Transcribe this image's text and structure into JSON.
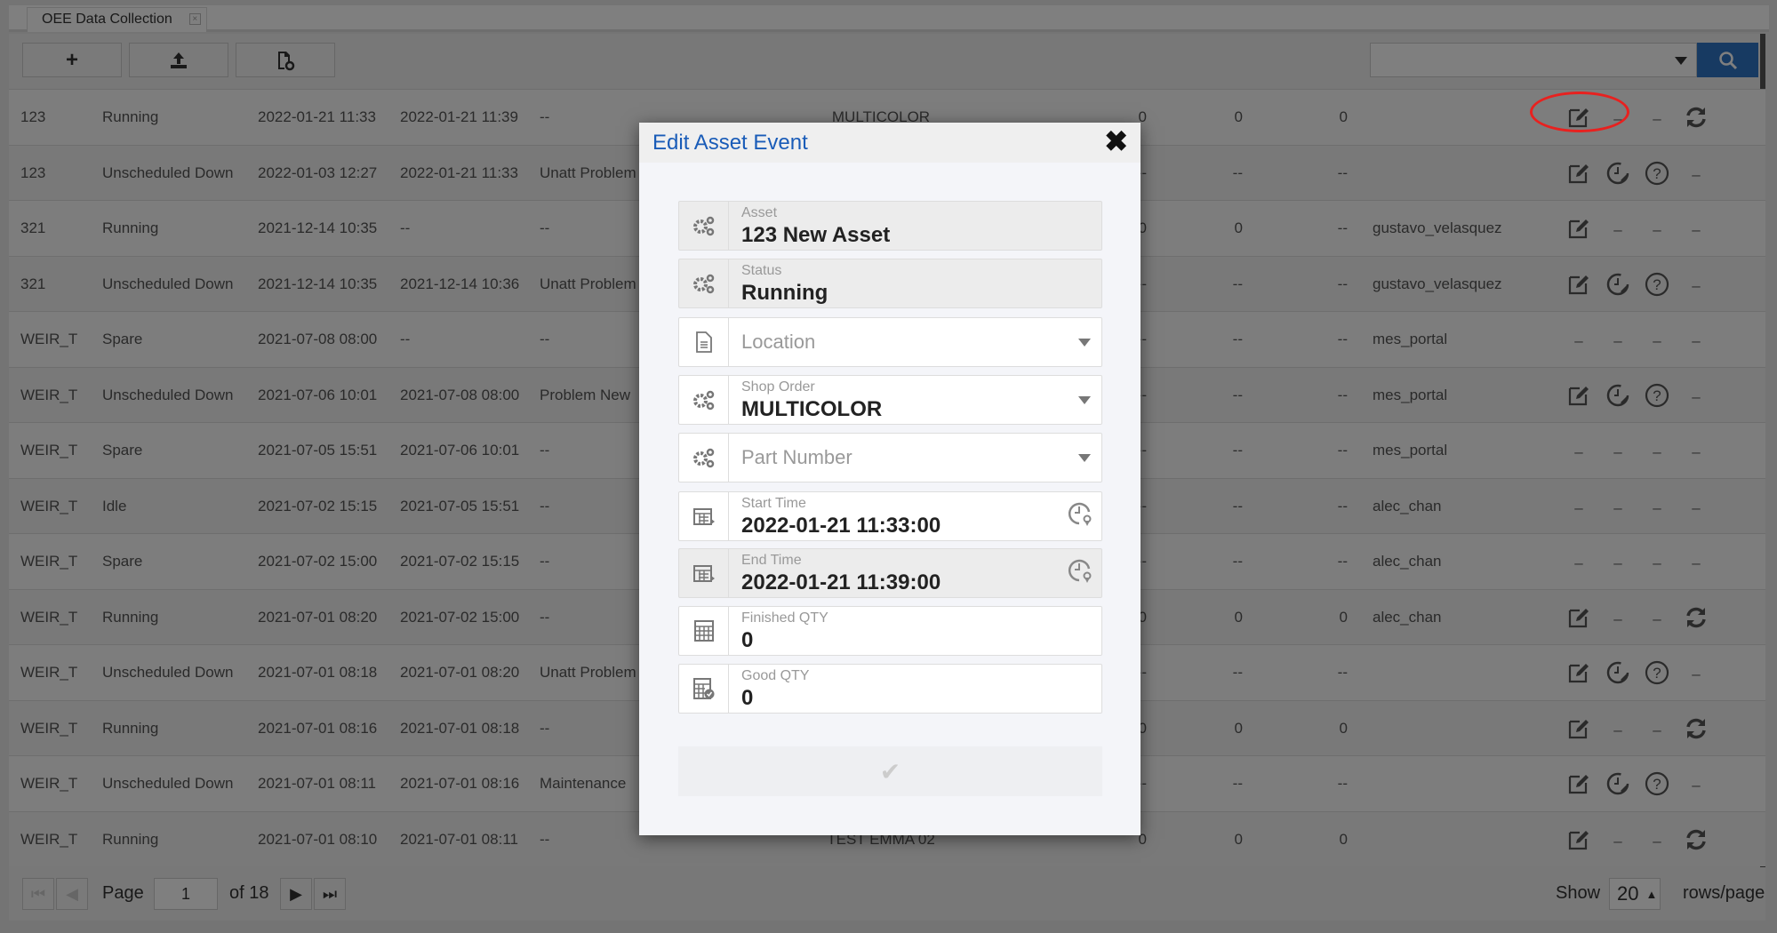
{
  "tab": {
    "title": "OEE Data Collection",
    "close": "×"
  },
  "toolbar": {
    "add_icon": "plus-icon",
    "upload_icon": "upload-icon",
    "report_icon": "file-gear-icon",
    "search_placeholder": "",
    "search_icon": "search-icon"
  },
  "colors": {
    "accent": "#2e74c4",
    "title": "#1a5cb8",
    "annotation": "#e8211f"
  },
  "rows": [
    [
      "123",
      "Running",
      "2022-01-21 11:33",
      "2022-01-21 11:39",
      "--",
      "MULTICOLOR",
      "0",
      "0",
      "0",
      "",
      [
        "edit",
        "-",
        "-",
        "refresh"
      ]
    ],
    [
      "123",
      "Unscheduled Down",
      "2022-01-03 12:27",
      "2022-01-21 11:33",
      "Unatt Problem",
      "",
      "--",
      "--",
      "--",
      "",
      [
        "edit",
        "clock",
        "help",
        "-"
      ]
    ],
    [
      "321",
      "Running",
      "2021-12-14 10:35",
      "--",
      "--",
      "",
      "0",
      "0",
      "--",
      "gustavo_velasquez",
      [
        "edit",
        "-",
        "-",
        "-"
      ]
    ],
    [
      "321",
      "Unscheduled Down",
      "2021-12-14 10:35",
      "2021-12-14 10:36",
      "Unatt Problem",
      "",
      "--",
      "--",
      "--",
      "gustavo_velasquez",
      [
        "edit",
        "clock",
        "help",
        "-"
      ]
    ],
    [
      "WEIR_T",
      "Spare",
      "2021-07-08 08:00",
      "--",
      "--",
      "",
      "--",
      "--",
      "--",
      "mes_portal",
      [
        "-",
        "-",
        "-",
        "-"
      ]
    ],
    [
      "WEIR_T",
      "Unscheduled Down",
      "2021-07-06 10:01",
      "2021-07-08 08:00",
      "Problem New",
      "",
      "--",
      "--",
      "--",
      "mes_portal",
      [
        "edit",
        "clock",
        "help",
        "-"
      ]
    ],
    [
      "WEIR_T",
      "Spare",
      "2021-07-05 15:51",
      "2021-07-06 10:01",
      "--",
      "",
      "--",
      "--",
      "--",
      "mes_portal",
      [
        "-",
        "-",
        "-",
        "-"
      ]
    ],
    [
      "WEIR_T",
      "Idle",
      "2021-07-02 15:15",
      "2021-07-05 15:51",
      "--",
      "",
      "--",
      "--",
      "--",
      "alec_chan",
      [
        "-",
        "-",
        "-",
        "-"
      ]
    ],
    [
      "WEIR_T",
      "Spare",
      "2021-07-02 15:00",
      "2021-07-02 15:15",
      "--",
      "",
      "--",
      "--",
      "--",
      "alec_chan",
      [
        "-",
        "-",
        "-",
        "-"
      ]
    ],
    [
      "WEIR_T",
      "Running",
      "2021-07-01 08:20",
      "2021-07-02 15:00",
      "--",
      "",
      "0",
      "0",
      "0",
      "alec_chan",
      [
        "edit",
        "-",
        "-",
        "refresh"
      ]
    ],
    [
      "WEIR_T",
      "Unscheduled Down",
      "2021-07-01 08:18",
      "2021-07-01 08:20",
      "Unatt Problem",
      "",
      "--",
      "--",
      "--",
      "",
      [
        "edit",
        "clock",
        "help",
        "-"
      ]
    ],
    [
      "WEIR_T",
      "Running",
      "2021-07-01 08:16",
      "2021-07-01 08:18",
      "--",
      "",
      "0",
      "0",
      "0",
      "",
      [
        "edit",
        "-",
        "-",
        "refresh"
      ]
    ],
    [
      "WEIR_T",
      "Unscheduled Down",
      "2021-07-01 08:11",
      "2021-07-01 08:16",
      "Maintenance",
      "",
      "--",
      "--",
      "--",
      "",
      [
        "edit",
        "clock",
        "help",
        "-"
      ]
    ],
    [
      "WEIR_T",
      "Running",
      "2021-07-01 08:10",
      "2021-07-01 08:11",
      "--",
      "TEST EMMA 02",
      "0",
      "0",
      "0",
      "",
      [
        "edit",
        "-",
        "-",
        "refresh"
      ]
    ]
  ],
  "pager": {
    "page_label": "Page",
    "page": "1",
    "of_label": "of 18",
    "show_label": "Show",
    "rows_per_page": "20",
    "rows_label": "rows/page"
  },
  "modal": {
    "title": "Edit Asset Event",
    "close": "✖",
    "fields": [
      {
        "label": "Asset",
        "value": "123 New Asset",
        "icon": "gears-icon",
        "readonly": true
      },
      {
        "label": "Status",
        "value": "Running",
        "icon": "gears-icon",
        "readonly": true
      },
      {
        "placeholder": "Location",
        "icon": "document-icon",
        "dropdown": true
      },
      {
        "label": "Shop Order",
        "value": "MULTICOLOR",
        "icon": "gears-icon",
        "dropdown": true
      },
      {
        "placeholder": "Part Number",
        "icon": "gears-icon",
        "dropdown": true
      },
      {
        "label": "Start Time",
        "value": "2022-01-21 11:33:00",
        "icon": "calendar-icon",
        "clock": true
      },
      {
        "label": "End Time",
        "value": "2022-01-21 11:39:00",
        "icon": "calendar-icon",
        "clock": true,
        "readonly": true
      },
      {
        "label": "Finished QTY",
        "value": "0",
        "icon": "calculator-icon"
      },
      {
        "label": "Good QTY",
        "value": "0",
        "icon": "calculator-check-icon"
      }
    ],
    "submit_icon": "check-icon",
    "submit": "✔"
  }
}
